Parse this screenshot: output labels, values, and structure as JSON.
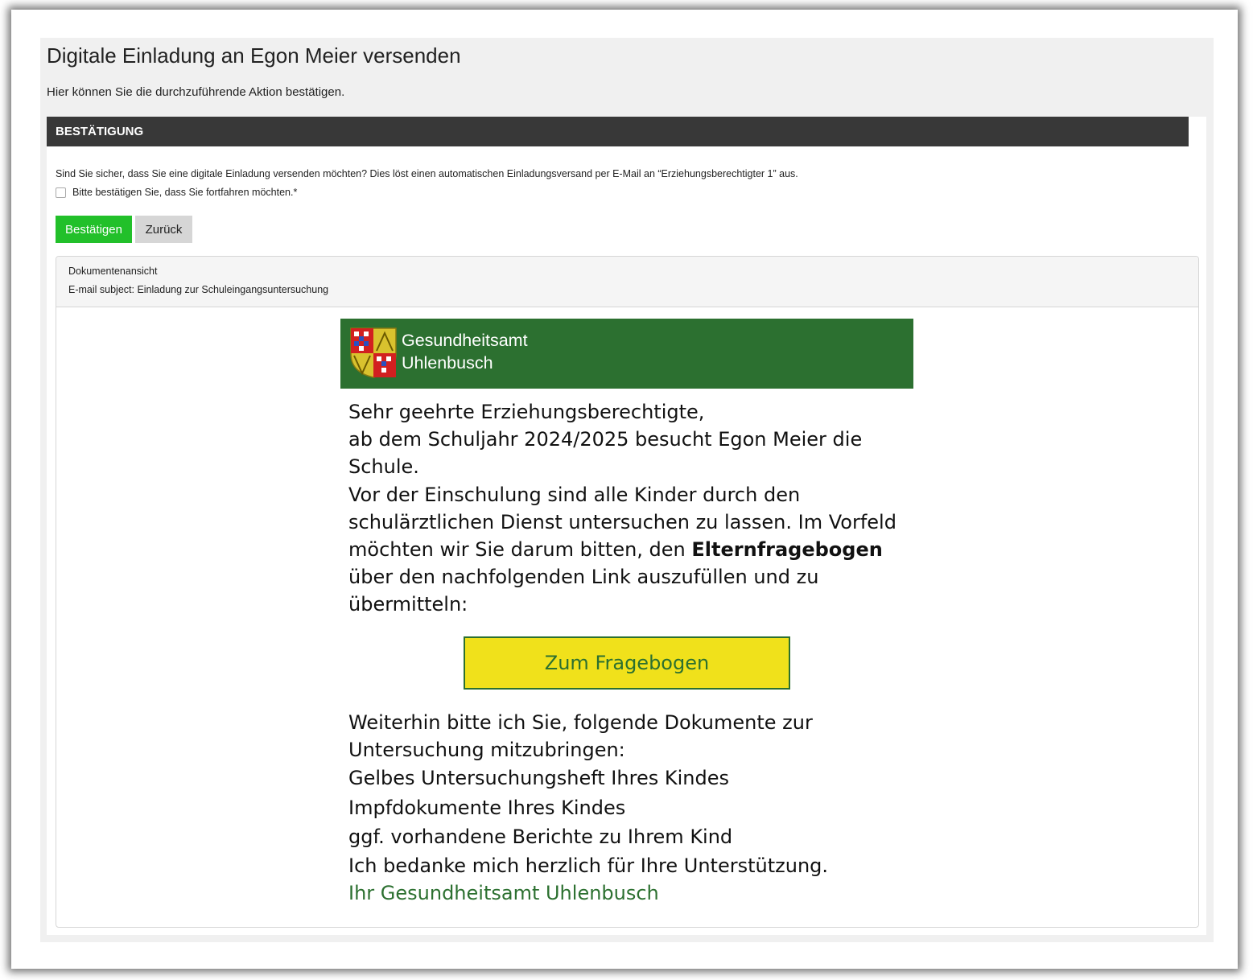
{
  "page": {
    "title": "Digitale Einladung an Egon Meier versenden",
    "subtitle": "Hier können Sie die durchzuführende Aktion bestätigen."
  },
  "panel": {
    "header": "BESTÄTIGUNG",
    "confirm_text": "Sind Sie sicher, dass Sie eine digitale Einladung versenden möchten? Dies löst einen automatischen Einladungsversand per E-Mail an “Erziehungsberechtigter 1” aus.",
    "checkbox_label": "Bitte bestätigen Sie, dass Sie fortfahren möchten.*",
    "checkbox_checked": false,
    "confirm_button": "Bestätigen",
    "back_button": "Zurück"
  },
  "document_view": {
    "title": "Dokumentenansicht",
    "subject": "E-mail subject: Einladung zur Schuleingangsuntersuchung"
  },
  "email": {
    "brand_line1": "Gesundheitsamt",
    "brand_line2": "Uhlenbusch",
    "greeting": "Sehr geehrte Erziehungsberechtigte,",
    "intro": "ab dem Schuljahr 2024/2025 besucht Egon Meier die Schule.",
    "para_before_bold": "Vor der Einschulung sind alle Kinder durch den schulärztlichen Dienst untersuchen zu lassen. Im Vorfeld möchten wir Sie darum bitten, den ",
    "para_bold": "Elternfragebogen",
    "para_after_bold": " über den nachfolgenden Link auszufüllen und zu übermitteln:",
    "cta_label": "Zum Fragebogen",
    "documents_intro": "Weiterhin bitte ich Sie, folgende Dokumente zur Untersuchung mitzubringen:",
    "documents": [
      "Gelbes Untersuchungsheft Ihres Kindes",
      "Impfdokumente Ihres Kindes",
      "ggf. vorhandene Berichte zu Ihrem Kind"
    ],
    "thanks": "Ich bedanke mich herzlich für Ihre Unterstützung.",
    "signature": "Ihr Gesundheitsamt Uhlenbusch"
  },
  "colors": {
    "header_dark": "#383838",
    "confirm_green": "#22c02a",
    "brand_green": "#2c7030",
    "cta_yellow": "#f0e11b"
  },
  "icons": {
    "crest": "coat-of-arms-icon"
  }
}
